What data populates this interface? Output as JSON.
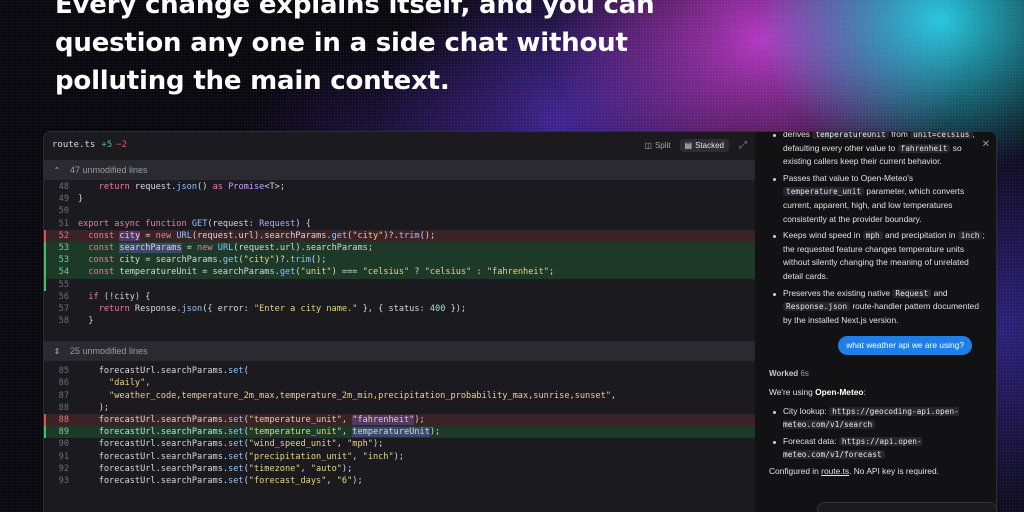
{
  "headline": "Every change explains itself, and you can question any one in a side chat without polluting the main context.",
  "diff": {
    "filename": "route.ts",
    "additions": "+5",
    "deletions": "−2",
    "split_label": "Split",
    "stacked_label": "Stacked",
    "hunk1_label": "47 unmodified lines",
    "hunk2_label": "25 unmodified lines"
  },
  "code_a": [
    {
      "n": "48",
      "type": "ctx",
      "html": "    <span class=\"kw\">return</span> request.<span class=\"fn\">json</span>() <span class=\"kw\">as</span> <span class=\"ty\">Promise</span>&lt;T&gt;;"
    },
    {
      "n": "49",
      "type": "ctx",
      "html": "}"
    },
    {
      "n": "50",
      "type": "ctx",
      "html": ""
    },
    {
      "n": "51",
      "type": "ctx",
      "html": "<span class=\"kw\">export async function</span> <span class=\"fn\">GET</span>(request: <span class=\"ty\">Request</span>) {"
    },
    {
      "n": "52",
      "type": "rm",
      "html": "  <span class=\"kw\">const</span> <span class=\"hl\">city</span> = <span class=\"kw\">new</span> <span class=\"fn\">URL</span>(request.url).searchParams.<span class=\"fn\">get</span>(<span class=\"st\">\"city\"</span>)?.<span class=\"fn\">trim</span>();"
    },
    {
      "n": "53",
      "type": "ad",
      "html": "  <span class=\"kw\">const</span> <span class=\"hl\">searchParams</span> = <span class=\"kw\">new</span> <span class=\"fn\">URL</span>(request.url).searchParams;"
    },
    {
      "n": "53",
      "type": "ad",
      "html": "  <span class=\"kw\">const</span> city = searchParams.<span class=\"fn\">get</span>(<span class=\"st\">\"city\"</span>)?.<span class=\"fn\">trim</span>();"
    },
    {
      "n": "54",
      "type": "ad",
      "html": "  <span class=\"kw\">const</span> temperatureUnit = searchParams.<span class=\"fn\">get</span>(<span class=\"st\">\"unit\"</span>) === <span class=\"st\">\"celsius\"</span> ? <span class=\"st\">\"celsius\"</span> : <span class=\"st\">\"fahrenheit\"</span>;"
    },
    {
      "n": "55",
      "type": "mk",
      "html": ""
    },
    {
      "n": "56",
      "type": "ctx",
      "html": "  <span class=\"kw\">if</span> (!city) {"
    },
    {
      "n": "57",
      "type": "ctx",
      "html": "    <span class=\"kw\">return</span> Response.<span class=\"fn\">json</span>({ error: <span class=\"st\">\"Enter a city name.\"</span> }, { status: <span class=\"nm\">400</span> });"
    },
    {
      "n": "58",
      "type": "ctx",
      "html": "  }"
    }
  ],
  "code_b": [
    {
      "n": "85",
      "type": "ctx",
      "html": "    forecastUrl.searchParams.<span class=\"fn\">set</span>("
    },
    {
      "n": "86",
      "type": "ctx",
      "html": "      <span class=\"st\">\"daily\"</span>,"
    },
    {
      "n": "87",
      "type": "ctx",
      "html": "      <span class=\"st\">\"weather_code,temperature_2m_max,temperature_2m_min,precipitation_probability_max,sunrise,sunset\"</span>,"
    },
    {
      "n": "88",
      "type": "ctx",
      "html": "    );"
    },
    {
      "n": "88",
      "type": "rm",
      "html": "    forecastUrl.searchParams.<span class=\"fn\">set</span>(<span class=\"st\">\"temperature_unit\"</span>, <span class=\"hl\"><span class=\"st\">\"fahrenheit\"</span></span>);"
    },
    {
      "n": "89",
      "type": "ad",
      "html": "    forecastUrl.searchParams.<span class=\"fn\">set</span>(<span class=\"st\">\"temperature_unit\"</span>, <span class=\"hl\">temperatureUnit</span>);"
    },
    {
      "n": "90",
      "type": "ctx",
      "html": "    forecastUrl.searchParams.<span class=\"fn\">set</span>(<span class=\"st\">\"wind_speed_unit\"</span>, <span class=\"st\">\"mph\"</span>);"
    },
    {
      "n": "91",
      "type": "ctx",
      "html": "    forecastUrl.searchParams.<span class=\"fn\">set</span>(<span class=\"st\">\"precipitation_unit\"</span>, <span class=\"st\">\"inch\"</span>);"
    },
    {
      "n": "92",
      "type": "ctx",
      "html": "    forecastUrl.searchParams.<span class=\"fn\">set</span>(<span class=\"st\">\"timezone\"</span>, <span class=\"st\">\"auto\"</span>);"
    },
    {
      "n": "93",
      "type": "ctx",
      "html": "    forecastUrl.searchParams.<span class=\"fn\">set</span>(<span class=\"st\">\"forecast_days\"</span>, <span class=\"st\">\"6\"</span>);"
    }
  ],
  "chat": {
    "bullets_top": [
      "derives <code>temperatureUnit</code> from <code>unit=celsius</code>, defaulting every other value to <code>fahrenheit</code> so existing callers keep their current behavior.",
      "Passes that value to Open-Meteo's <code>temperature_unit</code> parameter, which converts current, apparent, high, and low temperatures consistently at the provider boundary.",
      "Keeps wind speed in <code>mph</code> and precipitation in <code>inch</code>; the requested feature changes temperature units without silently changing the meaning of unrelated detail cards.",
      "Preserves the existing native <code>Request</code> and <code>Response.json</code> route-handler pattern documented by the installed Next.js version."
    ],
    "user_message": "what weather api we are using?",
    "worked_label": "Worked",
    "worked_time": "6s",
    "answer_intro": "We're using <b>Open-Meteo</b>:",
    "answer_bullets": [
      "City lookup: <code>https://geocoding-api.open-meteo.com/v1/search</code>",
      "Forecast data: <code>https://api.open-meteo.com/v1/forecast</code>"
    ],
    "answer_outro": "Configured in <span class=\"link\">route.ts</span>. No API key is required."
  }
}
